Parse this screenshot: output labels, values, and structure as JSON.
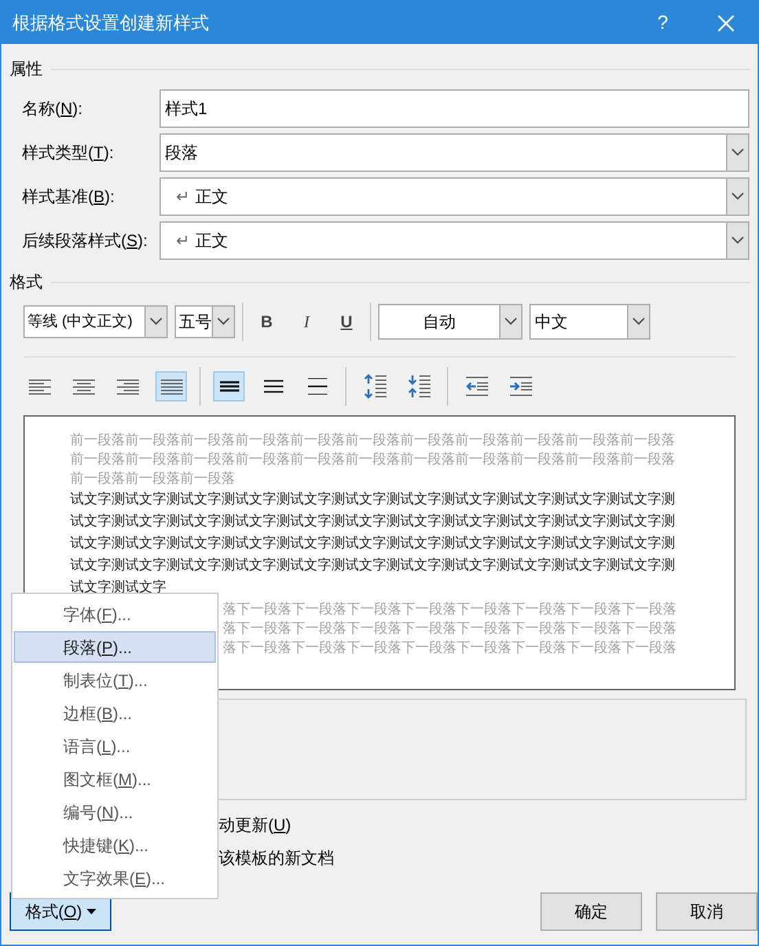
{
  "window": {
    "title": "根据格式设置创建新样式",
    "help": "?"
  },
  "properties": {
    "heading": "属性",
    "rows": [
      {
        "kind": "text",
        "label": {
          "pre": "名称(",
          "key": "N",
          "post": "):"
        },
        "value": "样式1"
      },
      {
        "kind": "select",
        "label": {
          "pre": "样式类型(",
          "key": "T",
          "post": "):"
        },
        "value": "段落"
      },
      {
        "kind": "select",
        "label": {
          "pre": "样式基准(",
          "key": "B",
          "post": "):"
        },
        "value": "正文",
        "mark": "↵"
      },
      {
        "kind": "select",
        "label": {
          "pre": "后续段落样式(",
          "key": "S",
          "post": "):"
        },
        "value": "正文",
        "mark": "↵"
      }
    ]
  },
  "format": {
    "heading": "格式",
    "font": "等线 (中文正文)",
    "size": "五号",
    "styles": [
      {
        "kind": "bold",
        "label": "B"
      },
      {
        "kind": "italic",
        "label": "I"
      },
      {
        "kind": "underline",
        "label": "U"
      }
    ],
    "font_color": "自动",
    "language": "中文",
    "align": [
      {
        "kind": "left",
        "selected": false
      },
      {
        "kind": "center",
        "selected": false
      },
      {
        "kind": "right",
        "selected": false
      },
      {
        "kind": "justify",
        "selected": true
      }
    ],
    "spacing": [
      {
        "kind": "single",
        "selected": true
      },
      {
        "kind": "onehalf",
        "selected": false
      },
      {
        "kind": "double",
        "selected": false
      }
    ],
    "paragraph_spacing": [
      {
        "kind": "increase"
      },
      {
        "kind": "decrease"
      }
    ],
    "indent": [
      {
        "kind": "decrease"
      },
      {
        "kind": "increase"
      }
    ]
  },
  "preview": {
    "before": [
      "前一段落前一段落前一段落前一段落前一段落前一段落前一段落前一段落前一段落前一段落前一段落",
      "前一段落前一段落前一段落前一段落前一段落前一段落前一段落前一段落前一段落前一段落前一段落",
      "前一段落前一段落前一段落"
    ],
    "body": [
      "试文字测试文字测试文字测试文字测试文字测试文字测试文字测试文字测试文字测试文字测试文字测",
      "试文字测试文字测试文字测试文字测试文字测试文字测试文字测试文字测试文字测试文字测试文字测",
      "试文字测试文字测试文字测试文字测试文字测试文字测试文字测试文字测试文字测试文字测试文字测",
      "试文字测试文字测试文字测试文字测试文字测试文字测试文字测试文字测试文字测试文字测试文字测",
      "试文字测试文字"
    ],
    "after": [
      "落下一段落下一段落下一段落下一段落下一段落下一段落下一段落下一段落",
      "落下一段落下一段落下一段落下一段落下一段落下一段落下一段落下一段落",
      "落下一段落下一段落下一段落下一段落下一段落下一段落下一段落下一段落"
    ]
  },
  "options": [
    {
      "pre": "动更新(",
      "key": "U",
      "post": ")"
    },
    {
      "pre": "该模板的新文档"
    }
  ],
  "format_menu": {
    "button": {
      "pre": "格式(",
      "key": "O",
      "post": ")"
    },
    "items": [
      {
        "pre": "字体(",
        "key": "F",
        "post": ")...",
        "selected": false
      },
      {
        "pre": "段落(",
        "key": "P",
        "post": ")...",
        "selected": true
      },
      {
        "pre": "制表位(",
        "key": "T",
        "post": ")...",
        "selected": false
      },
      {
        "pre": "边框(",
        "key": "B",
        "post": ")...",
        "selected": false
      },
      {
        "pre": "语言(",
        "key": "L",
        "post": ")...",
        "selected": false
      },
      {
        "pre": "图文框(",
        "key": "M",
        "post": ")...",
        "selected": false
      },
      {
        "pre": "编号(",
        "key": "N",
        "post": ")...",
        "selected": false
      },
      {
        "pre": "快捷键(",
        "key": "K",
        "post": ")...",
        "selected": false
      },
      {
        "pre": "文字效果(",
        "key": "E",
        "post": ")...",
        "selected": false
      }
    ]
  },
  "buttons": [
    "确定",
    "取消"
  ]
}
